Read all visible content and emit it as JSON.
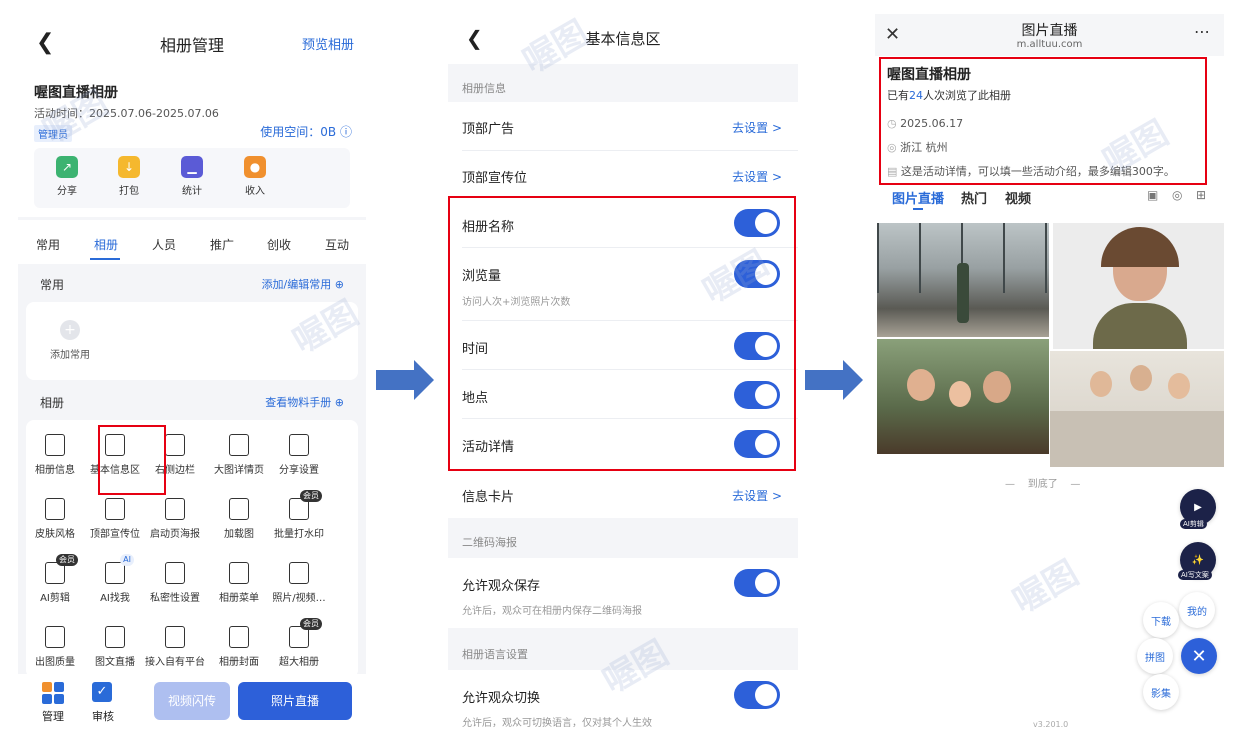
{
  "colors": {
    "accent": "#2a6bd8",
    "toggle_on": "#2d60d9",
    "highlight_box": "#e60012",
    "arrow": "#4472c4"
  },
  "panel1": {
    "title": "相册管理",
    "preview_link": "预览相册",
    "album_name": "喔图直播相册",
    "activity_time": "活动时间：2025.07.06-2025.07.06",
    "admin_badge": "管理员",
    "space_used": "使用空间：0B",
    "quick_actions": [
      {
        "label": "分享",
        "icon": "share-icon",
        "color": "#3cb371"
      },
      {
        "label": "打包",
        "icon": "package-icon",
        "color": "#f5b82e"
      },
      {
        "label": "统计",
        "icon": "stats-icon",
        "color": "#5b5bd6"
      },
      {
        "label": "收入",
        "icon": "income-icon",
        "color": "#f0902e"
      }
    ],
    "tabs": [
      "常用",
      "相册",
      "人员",
      "推广",
      "创收",
      "互动"
    ],
    "common_section": {
      "title": "常用",
      "link": "添加/编辑常用",
      "add_label": "添加常用"
    },
    "album_section": {
      "title": "相册",
      "link": "查看物料手册"
    },
    "grid": [
      {
        "label": "相册信息",
        "icon": "album-info-icon"
      },
      {
        "label": "基本信息区",
        "icon": "basic-info-icon"
      },
      {
        "label": "右侧边栏",
        "icon": "sidebar-icon"
      },
      {
        "label": "大图详情页",
        "icon": "info-circle-icon"
      },
      {
        "label": "分享设置",
        "icon": "share-settings-icon"
      },
      {
        "label": "皮肤风格",
        "icon": "skin-icon"
      },
      {
        "label": "顶部宣传位",
        "icon": "banner-icon"
      },
      {
        "label": "启动页海报",
        "icon": "poster-icon"
      },
      {
        "label": "加载图",
        "icon": "loading-icon"
      },
      {
        "label": "批量打水印",
        "icon": "watermark-icon",
        "badge": "会员"
      },
      {
        "label": "AI剪辑",
        "icon": "ai-cut-icon",
        "badge": "会员"
      },
      {
        "label": "AI找我",
        "icon": "ai-find-icon",
        "ai": "AI"
      },
      {
        "label": "私密性设置",
        "icon": "privacy-icon"
      },
      {
        "label": "相册菜单",
        "icon": "menu-icon"
      },
      {
        "label": "照片/视频…",
        "icon": "photo-video-icon"
      },
      {
        "label": "出图质量",
        "icon": "hd-icon"
      },
      {
        "label": "图文直播",
        "icon": "image-text-icon"
      },
      {
        "label": "接入自有平台",
        "icon": "platform-icon"
      },
      {
        "label": "相册封面",
        "icon": "cover-icon"
      },
      {
        "label": "超大相册",
        "icon": "large-album-icon",
        "badge": "会员"
      }
    ],
    "bottom": {
      "manage": "管理",
      "review": "审核",
      "video_flash": "视频闪传",
      "photo_live": "照片直播"
    }
  },
  "panel2": {
    "title": "基本信息区",
    "group_album_info": "相册信息",
    "top_ad": "顶部广告",
    "top_banner": "顶部宣传位",
    "set_link": "去设置 >",
    "toggles": [
      {
        "label": "相册名称",
        "on": true
      },
      {
        "label": "浏览量",
        "sub": "访问人次+浏览照片次数",
        "on": true
      },
      {
        "label": "时间",
        "on": true
      },
      {
        "label": "地点",
        "on": true
      },
      {
        "label": "活动详情",
        "on": true
      }
    ],
    "info_card": "信息卡片",
    "group_qr": "二维码海报",
    "allow_save": {
      "label": "允许观众保存",
      "sub": "允许后，观众可在相册内保存二维码海报",
      "on": true
    },
    "group_lang": "相册语言设置",
    "allow_switch": {
      "label": "允许观众切换",
      "sub": "允许后，观众可切换语言，仅对其个人生效",
      "on": true
    }
  },
  "panel3": {
    "title": "图片直播",
    "url": "m.alltuu.com",
    "album_name": "喔图直播相册",
    "views_prefix": "已有",
    "views_count": "24",
    "views_suffix": "人次浏览了此相册",
    "date": "2025.06.17",
    "location": "浙江 杭州",
    "detail": "这是活动详情，可以填一些活动介绍，最多编辑300字。",
    "tabs": [
      "图片直播",
      "热门",
      "视频"
    ],
    "end_text": "到底了",
    "fab_ai_edit": "AI剪辑",
    "fab_ai_write": "AI写文案",
    "fab_download": "下载",
    "fab_mine": "我的",
    "fab_collage": "拼图",
    "fab_video": "影集",
    "version": "v3.201.0"
  },
  "watermark": "喔图"
}
